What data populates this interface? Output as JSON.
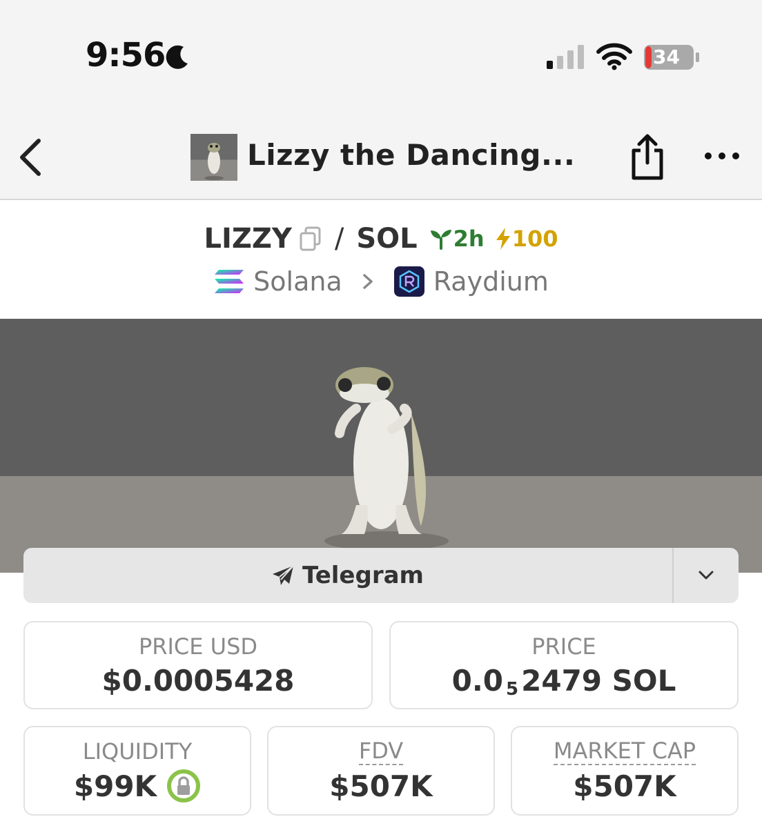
{
  "status_bar": {
    "time": "9:56",
    "battery_level": "34"
  },
  "nav": {
    "title": "Lizzy the Dancing..."
  },
  "pair": {
    "base": "LIZZY",
    "separator": "/",
    "quote": "SOL",
    "age": "2h",
    "boost": "100"
  },
  "route": {
    "chain": "Solana",
    "dex": "Raydium"
  },
  "links": {
    "telegram_label": "Telegram"
  },
  "stats": {
    "price_usd_label": "PRICE USD",
    "price_usd_value": "$0.0005428",
    "price_label": "PRICE",
    "price_lead": "0.0",
    "price_zeros": "5",
    "price_digits": "2479 SOL",
    "liquidity_label": "LIQUIDITY",
    "liquidity_value": "$99K",
    "fdv_label": "FDV",
    "fdv_value": "$507K",
    "mcap_label": "MARKET CAP",
    "mcap_value": "$507K"
  },
  "colors": {
    "age_green": "#2e7d32",
    "boost_gold": "#d4a200",
    "lock_green": "#8bc34a"
  }
}
